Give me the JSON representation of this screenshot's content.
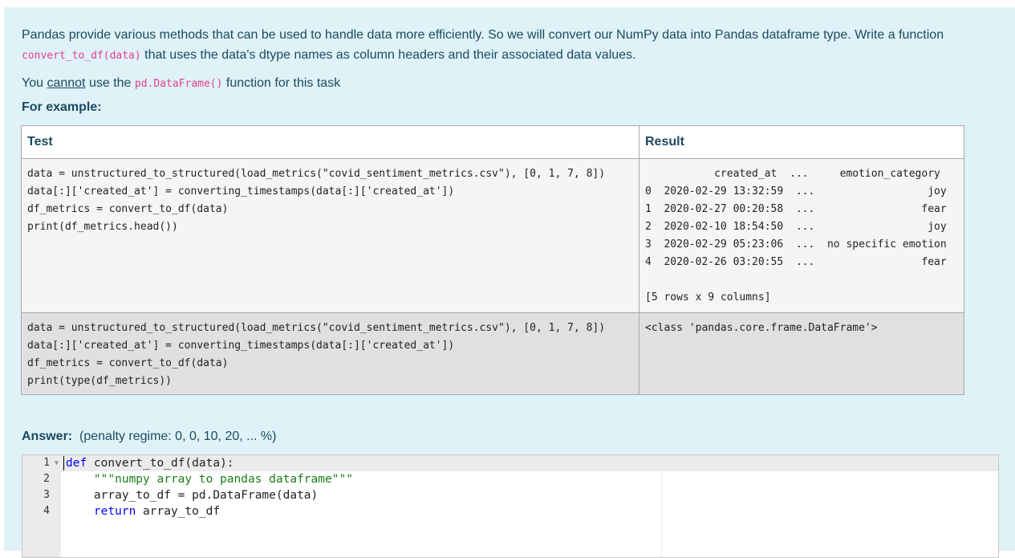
{
  "question": {
    "intro_before": "Pandas provide various methods that can be used to handle data more efficiently. So we will convert our NumPy data into Pandas dataframe type. Write a function ",
    "func_code": "convert_to_df(data)",
    "intro_after": " that uses the data's dtype names as column headers and their associated data values.",
    "restriction_before": "You ",
    "restriction_underline": "cannot",
    "restriction_middle": " use the ",
    "restriction_code": "pd.DataFrame()",
    "restriction_after": " function for this task",
    "example_heading": "For example:"
  },
  "examples_table": {
    "headers": {
      "test": "Test",
      "result": "Result"
    },
    "rows": [
      {
        "test": "data = unstructured_to_structured(load_metrics(\"covid_sentiment_metrics.csv\"), [0, 1, 7, 8])\ndata[:]['created_at'] = converting_timestamps(data[:]['created_at'])\ndf_metrics = convert_to_df(data)\nprint(df_metrics.head())",
        "result": "           created_at  ...     emotion_category\n0  2020-02-29 13:32:59  ...                  joy\n1  2020-02-27 00:20:58  ...                 fear\n2  2020-02-10 18:54:50  ...                  joy\n3  2020-02-29 05:23:06  ...  no specific emotion\n4  2020-02-26 03:20:55  ...                 fear\n\n[5 rows x 9 columns]"
      },
      {
        "test": "data = unstructured_to_structured(load_metrics(\"covid_sentiment_metrics.csv\"), [0, 1, 7, 8])\ndata[:]['created_at'] = converting_timestamps(data[:]['created_at'])\ndf_metrics = convert_to_df(data)\nprint(type(df_metrics))",
        "result": "<class 'pandas.core.frame.DataFrame'>"
      }
    ]
  },
  "answer": {
    "label": "Answer:",
    "penalty": "(penalty regime: 0, 0, 10, 20, ... %)"
  },
  "editor": {
    "line_numbers": [
      "1",
      "2",
      "3",
      "4"
    ],
    "fold_icon": "fold-arrow-icon",
    "lines": {
      "l1_kw": "def",
      "l1_rest": " convert_to_df(data):",
      "l2_str": "    \"\"\"numpy array to pandas dataframe\"\"\"",
      "l3": "    array_to_df = pd.DataFrame(data)",
      "l4_indent": "    ",
      "l4_kw": "return",
      "l4_rest": " array_to_df"
    }
  }
}
